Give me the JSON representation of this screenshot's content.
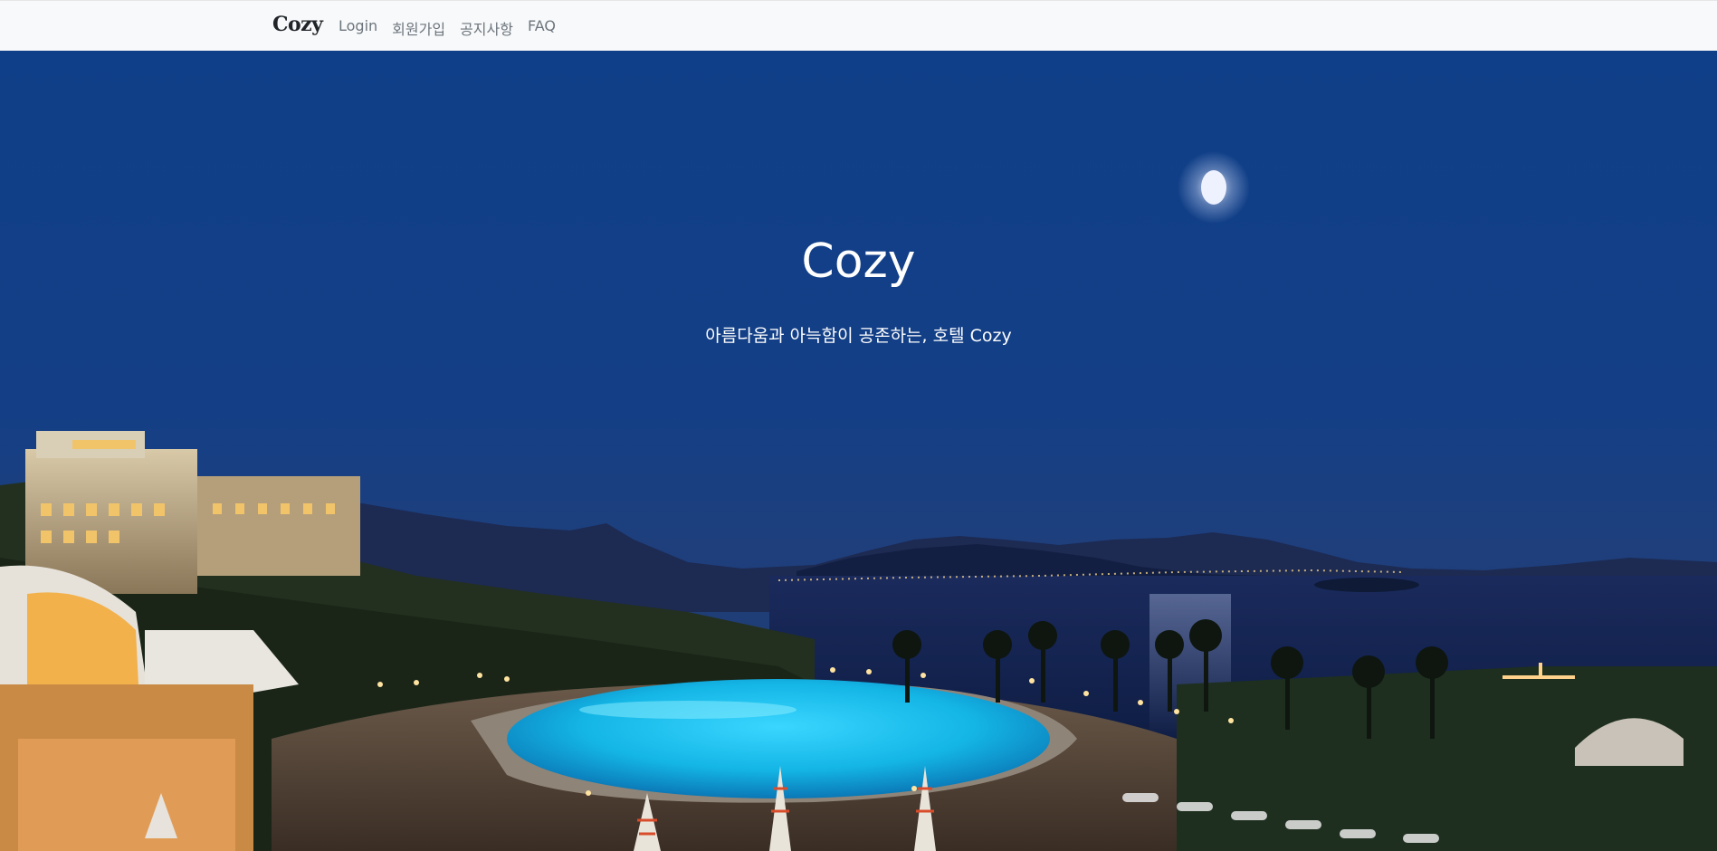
{
  "navbar": {
    "brand": "Cozy",
    "links": [
      {
        "label": "Login"
      },
      {
        "label": "회원가입"
      },
      {
        "label": "공지사항"
      },
      {
        "label": "FAQ"
      }
    ]
  },
  "hero": {
    "title": "Cozy",
    "subtitle": "아름다움과 아늑함이 공존하는, 호텔 Cozy"
  },
  "colors": {
    "navbar_bg": "#f8f9fa",
    "sky_top": "#0f3f88",
    "sky_bottom": "#1c3c7a",
    "pool": "#14b6e6"
  }
}
